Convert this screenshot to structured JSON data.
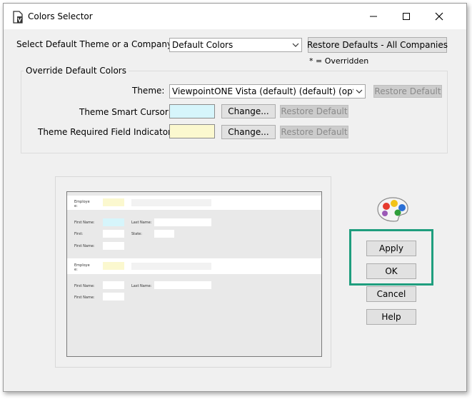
{
  "window": {
    "title": "Colors Selector"
  },
  "theme_select": {
    "label": "Select Default Theme or a Company:",
    "value": "Default Colors",
    "restore_all_label": "Restore Defaults - All Companies",
    "overridden_note": "* = Overridden"
  },
  "override_group": {
    "title": "Override Default Colors",
    "theme_label": "Theme:",
    "theme_value": "ViewpointONE Vista (default) (default) (optimized for",
    "restore_label": "Restore Default",
    "change_label": "Change...",
    "smart_cursor_label": "Theme Smart Cursor:",
    "required_label": "Theme Required Field Indicator:"
  },
  "colors": {
    "smart_cursor": "#d6f5fb",
    "required_indicator": "#fbf8cf",
    "highlight": "#1f9e7e"
  },
  "preview": {
    "employee": "Employe\ne:",
    "first_name": "First Name:",
    "last_name": "Last Name:",
    "first": "First:",
    "state": "State:"
  },
  "actions": {
    "apply": "Apply",
    "ok": "OK",
    "cancel": "Cancel",
    "help": "Help"
  }
}
